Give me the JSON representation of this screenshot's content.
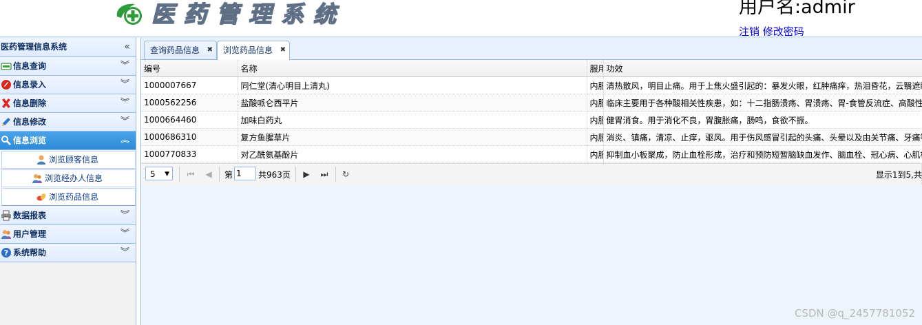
{
  "header": {
    "app_title": "医药管理系统",
    "username_line": "用户名:admir",
    "links": [
      "注销",
      "修改密码"
    ]
  },
  "sidebar": {
    "title": "医药管理信息系统",
    "items": [
      {
        "label": "信息查询"
      },
      {
        "label": "信息录入"
      },
      {
        "label": "信息删除"
      },
      {
        "label": "信息修改"
      },
      {
        "label": "信息浏览",
        "active": true
      },
      {
        "label": "数据报表"
      },
      {
        "label": "用户管理"
      },
      {
        "label": "系统帮助"
      }
    ],
    "browse_subitems": [
      "浏览顾客信息",
      "浏览经办人信息",
      "浏览药品信息"
    ]
  },
  "tabs": [
    {
      "label": "查询药品信息"
    },
    {
      "label": "浏览药品信息",
      "active": true
    }
  ],
  "grid": {
    "columns": [
      "编号",
      "名称",
      "服用",
      "功效"
    ],
    "rows": [
      [
        "1000007667",
        "同仁堂(清心明目上清丸)",
        "内服",
        "清热散风，明目止痛。用于上焦火盛引起的：暴发火眼，红肿痛痒，热泪昏花，云翳遮睛"
      ],
      [
        "1000562256",
        "盐酸哌仑西平片",
        "内服",
        "临床主要用于各种酸相关性疾患，如：十二指肠溃疡、胃溃疡、胃-食管反流症、高酸性胃炎"
      ],
      [
        "1000664460",
        "加味白药丸",
        "内服",
        "健胃消食。用于消化不良，胃腹胀痛，肠鸣，食欲不振。"
      ],
      [
        "1000686310",
        "复方鱼腥草片",
        "内服",
        "消炎、镇痛，清凉、止痒，驱风。用于伤风感冒引起的头痛、头晕以及由关节痛、牙痛等"
      ],
      [
        "1000770833",
        "对乙酰氨基酚片",
        "内服",
        "抑制血小板聚成，防止血栓形成，治疗和预防短暂脑缺血发作、脑血栓、冠心病、心肌梗死"
      ]
    ]
  },
  "pager": {
    "page_size": "5",
    "page_label": "第",
    "page_value": "1",
    "total_pages": "共963页",
    "summary": "显示1到5,共"
  },
  "watermark": "CSDN @q_2457781052"
}
